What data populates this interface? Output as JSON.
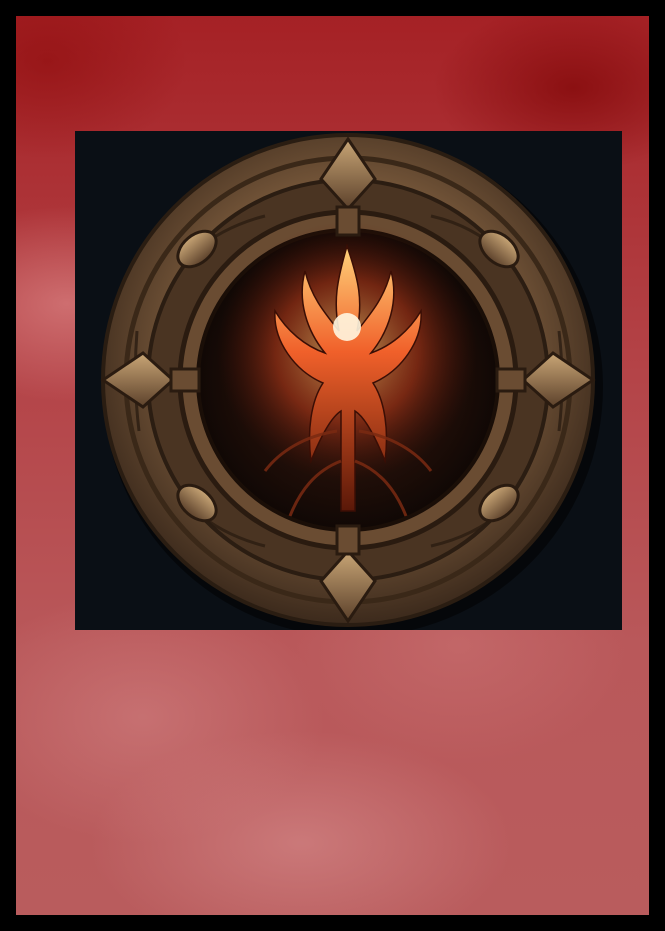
{
  "card": {
    "frame_color": "#000000",
    "background_color": "#b44448",
    "art_background_color": "#0a0f15",
    "art": {
      "icon": "flame-sigil-medallion-icon",
      "accent_color": "#ff6a2a",
      "metal_color": "#8a6a4a"
    }
  }
}
